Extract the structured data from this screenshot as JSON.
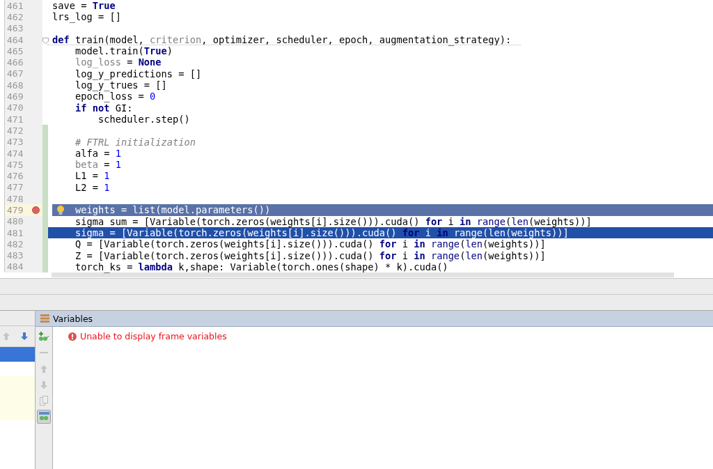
{
  "editor": {
    "lines": [
      {
        "number": "461",
        "tokens": [
          {
            "kind": "plain",
            "text": "save = "
          },
          {
            "kind": "keyword",
            "text": "True"
          }
        ],
        "breakpoint": false,
        "selected": false,
        "bulb": false,
        "fold": false,
        "changed": false
      },
      {
        "number": "462",
        "tokens": [
          {
            "kind": "plain",
            "text": "lrs_log = []"
          }
        ],
        "breakpoint": false,
        "selected": false,
        "bulb": false,
        "fold": false,
        "changed": false
      },
      {
        "number": "463",
        "breakpoint": false,
        "selected": false,
        "bulb": false,
        "fold": false,
        "changed": false
      },
      {
        "number": "464",
        "tokens": [
          {
            "kind": "keyword",
            "text": "def"
          },
          {
            "kind": "plain",
            "text": " train(model, "
          },
          {
            "kind": "unused",
            "text": "criterion"
          },
          {
            "kind": "plain",
            "text": ", optimizer, scheduler, epoch, augmentation_strategy):"
          }
        ],
        "breakpoint": false,
        "selected": false,
        "bulb": false,
        "fold": true,
        "changed": false
      },
      {
        "number": "465",
        "tokens": [
          {
            "kind": "plain",
            "text": "    model.train("
          },
          {
            "kind": "keyword",
            "text": "True"
          },
          {
            "kind": "plain",
            "text": ")"
          }
        ],
        "breakpoint": false,
        "selected": false,
        "bulb": false,
        "fold": false,
        "changed": false
      },
      {
        "number": "466",
        "tokens": [
          {
            "kind": "unused",
            "text": "    log_loss"
          },
          {
            "kind": "plain",
            "text": " = "
          },
          {
            "kind": "keyword",
            "text": "None"
          }
        ],
        "breakpoint": false,
        "selected": false,
        "bulb": false,
        "fold": false,
        "changed": false
      },
      {
        "number": "467",
        "tokens": [
          {
            "kind": "plain",
            "text": "    log_y_predictions = []"
          }
        ],
        "breakpoint": false,
        "selected": false,
        "bulb": false,
        "fold": false,
        "changed": false
      },
      {
        "number": "468",
        "tokens": [
          {
            "kind": "plain",
            "text": "    log_y_trues = []"
          }
        ],
        "breakpoint": false,
        "selected": false,
        "bulb": false,
        "fold": false,
        "changed": false
      },
      {
        "number": "469",
        "tokens": [
          {
            "kind": "plain",
            "text": "    epoch_loss = "
          },
          {
            "kind": "number",
            "text": "0"
          }
        ],
        "breakpoint": false,
        "selected": false,
        "bulb": false,
        "fold": false,
        "changed": false
      },
      {
        "number": "470",
        "tokens": [
          {
            "kind": "keyword",
            "text": "    if not"
          },
          {
            "kind": "plain",
            "text": " GI:"
          }
        ],
        "breakpoint": false,
        "selected": false,
        "bulb": false,
        "fold": false,
        "changed": false
      },
      {
        "number": "471",
        "tokens": [
          {
            "kind": "plain",
            "text": "        scheduler.step()"
          }
        ],
        "breakpoint": false,
        "selected": false,
        "bulb": false,
        "fold": false,
        "changed": false
      },
      {
        "number": "472",
        "breakpoint": false,
        "selected": false,
        "bulb": false,
        "fold": false,
        "changed": true
      },
      {
        "number": "473",
        "tokens": [
          {
            "kind": "comment",
            "text": "    # FTRL initialization"
          }
        ],
        "breakpoint": false,
        "selected": false,
        "bulb": false,
        "fold": false,
        "changed": true
      },
      {
        "number": "474",
        "tokens": [
          {
            "kind": "plain",
            "text": "    alfa = "
          },
          {
            "kind": "number",
            "text": "1"
          }
        ],
        "breakpoint": false,
        "selected": false,
        "bulb": false,
        "fold": false,
        "changed": true
      },
      {
        "number": "475",
        "tokens": [
          {
            "kind": "unused",
            "text": "    beta"
          },
          {
            "kind": "plain",
            "text": " = "
          },
          {
            "kind": "number",
            "text": "1"
          }
        ],
        "breakpoint": false,
        "selected": false,
        "bulb": false,
        "fold": false,
        "changed": true
      },
      {
        "number": "476",
        "tokens": [
          {
            "kind": "plain",
            "text": "    L1 = "
          },
          {
            "kind": "number",
            "text": "1"
          }
        ],
        "breakpoint": false,
        "selected": false,
        "bulb": false,
        "fold": false,
        "changed": true
      },
      {
        "number": "477",
        "tokens": [
          {
            "kind": "plain",
            "text": "    L2 = "
          },
          {
            "kind": "number",
            "text": "1"
          }
        ],
        "breakpoint": false,
        "selected": false,
        "bulb": false,
        "fold": false,
        "changed": true
      },
      {
        "number": "478",
        "breakpoint": false,
        "selected": false,
        "bulb": false,
        "fold": false,
        "changed": true
      },
      {
        "number": "479",
        "tokens": [
          {
            "kind": "plain",
            "text": "    weights = list(model.parameters())"
          }
        ],
        "breakpoint": true,
        "selected": false,
        "bulb": true,
        "fold": false,
        "changed": true
      },
      {
        "number": "480",
        "tokens": [
          {
            "kind": "plain",
            "text": "    sigma_sum = [Variable(torch.zeros(weights[i].size())).cuda() "
          },
          {
            "kind": "keyword",
            "text": "for"
          },
          {
            "kind": "plain",
            "text": " i "
          },
          {
            "kind": "keyword",
            "text": "in"
          },
          {
            "kind": "builtin",
            "text": " range"
          },
          {
            "kind": "plain",
            "text": "("
          },
          {
            "kind": "builtin",
            "text": "len"
          },
          {
            "kind": "plain",
            "text": "(weights))]"
          }
        ],
        "breakpoint": false,
        "selected": false,
        "bulb": false,
        "fold": false,
        "changed": true
      },
      {
        "number": "481",
        "tokens": [
          {
            "kind": "plain",
            "text": "    sigma = [Variable(torch.zeros(weights[i].size())).cuda() "
          },
          {
            "kind": "keyword",
            "text": "for"
          },
          {
            "kind": "plain",
            "text": " i "
          },
          {
            "kind": "keyword",
            "text": "in"
          },
          {
            "kind": "builtin",
            "text": " range"
          },
          {
            "kind": "plain",
            "text": "("
          },
          {
            "kind": "builtin",
            "text": "len"
          },
          {
            "kind": "plain",
            "text": "(weights))]"
          }
        ],
        "breakpoint": false,
        "selected": true,
        "bulb": false,
        "fold": false,
        "changed": true
      },
      {
        "number": "482",
        "tokens": [
          {
            "kind": "plain",
            "text": "    Q = [Variable(torch.zeros(weights[i].size())).cuda() "
          },
          {
            "kind": "keyword",
            "text": "for"
          },
          {
            "kind": "plain",
            "text": " i "
          },
          {
            "kind": "keyword",
            "text": "in"
          },
          {
            "kind": "builtin",
            "text": " range"
          },
          {
            "kind": "plain",
            "text": "("
          },
          {
            "kind": "builtin",
            "text": "len"
          },
          {
            "kind": "plain",
            "text": "(weights))]"
          }
        ],
        "breakpoint": false,
        "selected": false,
        "bulb": false,
        "fold": false,
        "changed": true
      },
      {
        "number": "483",
        "tokens": [
          {
            "kind": "plain",
            "text": "    Z = [Variable(torch.zeros(weights[i].size())).cuda() "
          },
          {
            "kind": "keyword",
            "text": "for"
          },
          {
            "kind": "plain",
            "text": " i "
          },
          {
            "kind": "keyword",
            "text": "in"
          },
          {
            "kind": "builtin",
            "text": " range"
          },
          {
            "kind": "plain",
            "text": "("
          },
          {
            "kind": "builtin",
            "text": "len"
          },
          {
            "kind": "plain",
            "text": "(weights))]"
          }
        ],
        "breakpoint": false,
        "selected": false,
        "bulb": false,
        "fold": false,
        "changed": true
      },
      {
        "number": "484",
        "tokens": [
          {
            "kind": "plain",
            "text": "    torch_ks = "
          },
          {
            "kind": "keyword",
            "text": "lambda"
          },
          {
            "kind": "plain",
            "text": " k,shape: Variable(torch.ones(shape) * k).cuda()"
          }
        ],
        "breakpoint": false,
        "selected": false,
        "bulb": false,
        "fold": false,
        "changed": true
      }
    ]
  },
  "frames": {
    "toolbar": [
      {
        "kind": "up",
        "disabled": true
      },
      {
        "kind": "down",
        "disabled": false
      }
    ],
    "rows": [
      {
        "selected": true,
        "kind": "frame"
      },
      {
        "selected": false,
        "kind": "frame"
      },
      {
        "selected": false,
        "kind": "library"
      },
      {
        "selected": false,
        "kind": "library"
      },
      {
        "selected": false,
        "kind": "library"
      }
    ]
  },
  "variables": {
    "title": "Variables",
    "message": "Unable to display frame variables",
    "toolbar": [
      {
        "kind": "add_watch",
        "disabled": false,
        "pressed": false
      },
      {
        "kind": "remove",
        "disabled": true,
        "pressed": false
      },
      {
        "kind": "up",
        "disabled": true,
        "pressed": false
      },
      {
        "kind": "down",
        "disabled": true,
        "pressed": false
      },
      {
        "kind": "copy",
        "disabled": true,
        "pressed": false
      },
      {
        "kind": "watches",
        "disabled": false,
        "pressed": true
      }
    ]
  }
}
